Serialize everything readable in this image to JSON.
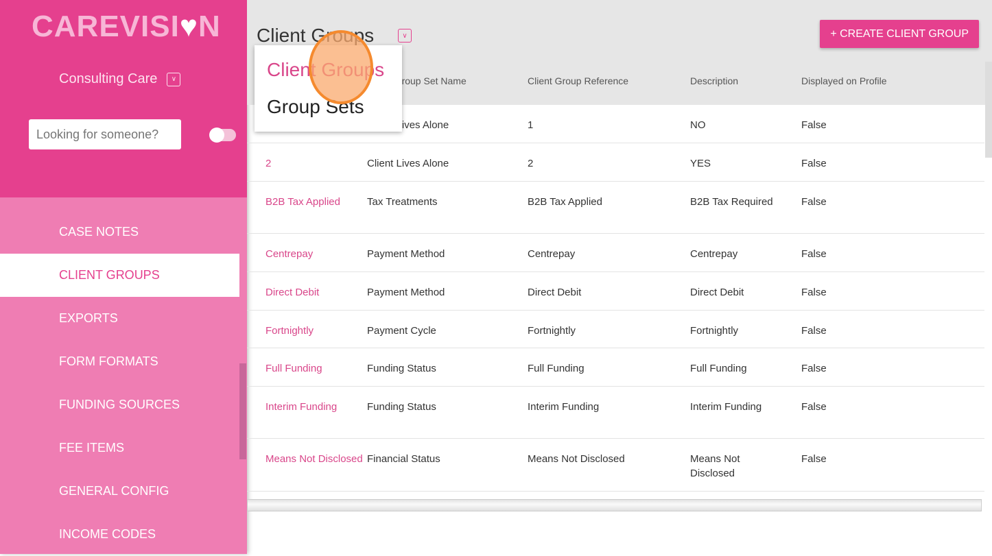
{
  "sidebar": {
    "logo": "CAREVISION",
    "organisation": "Consulting Care",
    "search_placeholder": "Looking for someone?",
    "items": [
      {
        "label": "CASE NOTES"
      },
      {
        "label": "CLIENT GROUPS",
        "active": true
      },
      {
        "label": "EXPORTS"
      },
      {
        "label": "FORM FORMATS"
      },
      {
        "label": "FUNDING SOURCES"
      },
      {
        "label": "FEE ITEMS"
      },
      {
        "label": "GENERAL CONFIG"
      },
      {
        "label": "INCOME CODES"
      }
    ]
  },
  "header": {
    "title": "Client Groups",
    "create_label": "+ CREATE CLIENT GROUP"
  },
  "dropdown": {
    "items": [
      "Client Groups",
      "Group Sets"
    ]
  },
  "table": {
    "columns": [
      "",
      "Client Group Set Name",
      "Client Group Reference",
      "Description",
      "Displayed on Profile"
    ],
    "rows": [
      [
        "",
        "Client Lives Alone",
        "1",
        "NO",
        "False"
      ],
      [
        "2",
        "Client Lives Alone",
        "2",
        "YES",
        "False"
      ],
      [
        "B2B Tax Applied",
        "Tax Treatments",
        "B2B Tax Applied",
        "B2B Tax Required",
        "False"
      ],
      [
        "Centrepay",
        "Payment Method",
        "Centrepay",
        "Centrepay",
        "False"
      ],
      [
        "Direct Debit",
        "Payment Method",
        "Direct Debit",
        "Direct Debit",
        "False"
      ],
      [
        "Fortnightly",
        "Payment Cycle",
        "Fortnightly",
        "Fortnightly",
        "False"
      ],
      [
        "Full Funding",
        "Funding Status",
        "Full Funding",
        "Full Funding",
        "False"
      ],
      [
        "Interim Funding",
        "Funding Status",
        "Interim Funding",
        "Interim Funding",
        "False"
      ],
      [
        "Means Not Disclosed",
        "Financial Status",
        "Means Not Disclosed",
        "Means Not Disclosed",
        "False"
      ]
    ]
  },
  "colors": {
    "brand": "#e5408e",
    "menu": "#ef7db3"
  }
}
